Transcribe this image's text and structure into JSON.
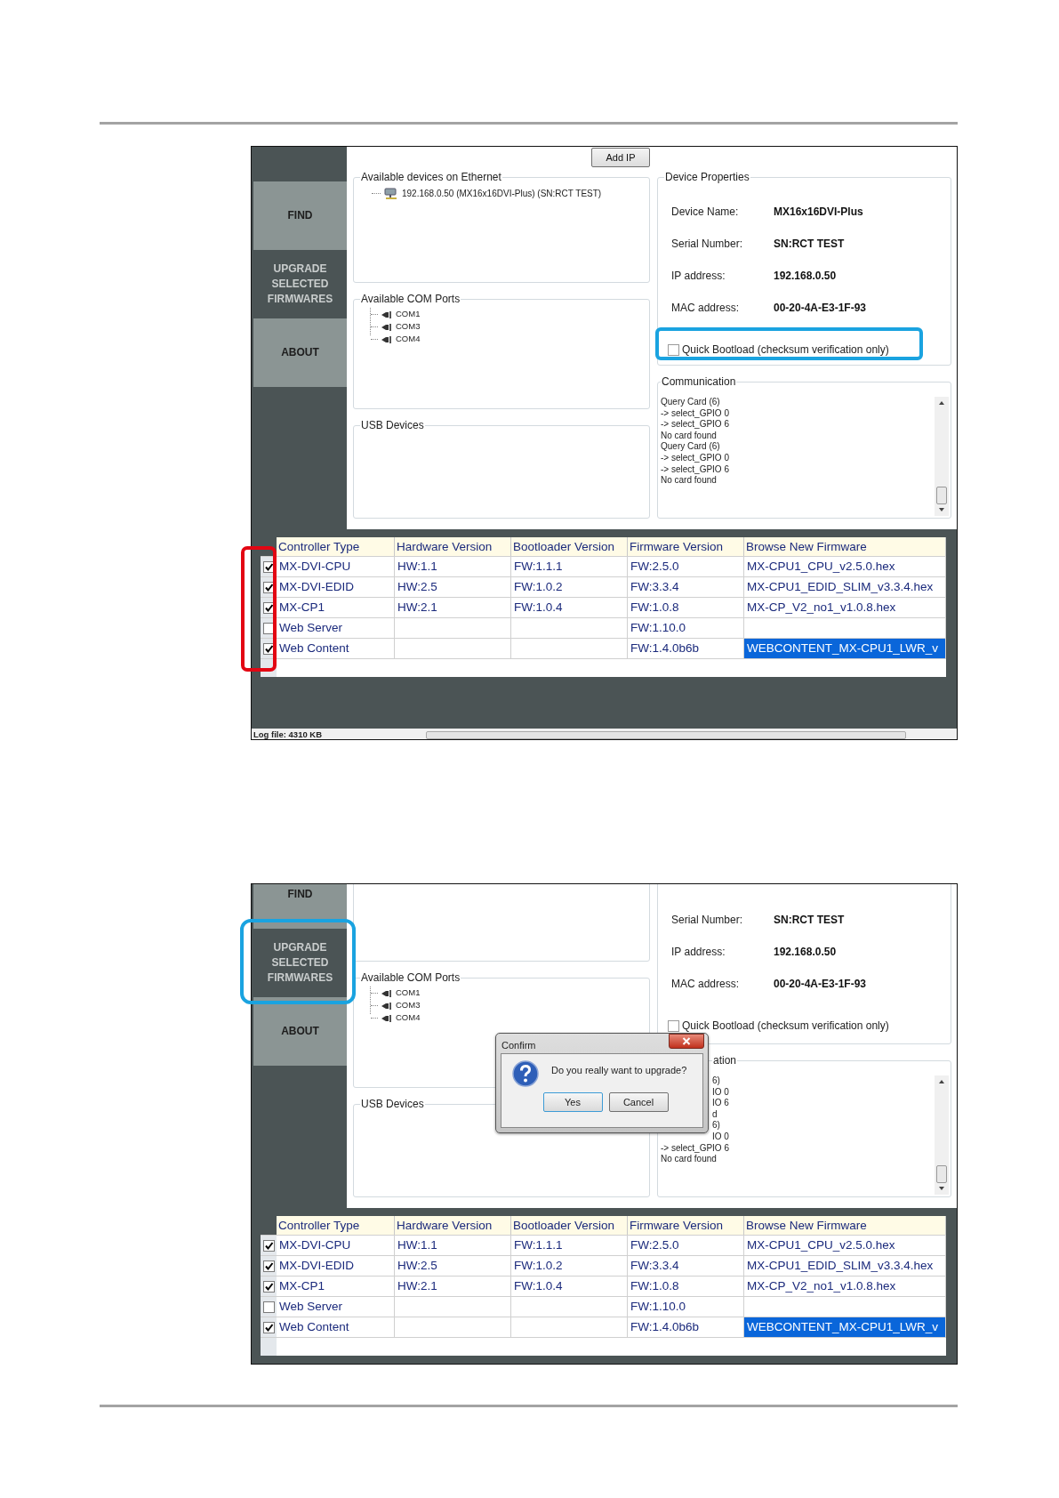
{
  "screenshots": [
    {
      "kind": "full",
      "sidebar": [
        {
          "label": "FIND",
          "selected": false
        },
        {
          "label": "UPGRADE SELECTED FIRMWARES",
          "selected": true
        },
        {
          "label": "ABOUT",
          "selected": false
        }
      ],
      "add_ip_button": "Add IP",
      "ethernet": {
        "title": "Available devices on Ethernet",
        "devices": [
          "192.168.0.50 (MX16x16DVI-Plus) (SN:RCT TEST)"
        ]
      },
      "com_ports": {
        "title": "Available COM Ports",
        "ports": [
          "COM1",
          "COM3",
          "COM4"
        ]
      },
      "usb": {
        "title": "USB Devices"
      },
      "device_properties": {
        "title": "Device Properties",
        "fields": [
          {
            "label": "Device Name:",
            "value": "MX16x16DVI-Plus"
          },
          {
            "label": "Serial Number:",
            "value": "SN:RCT TEST"
          },
          {
            "label": "IP address:",
            "value": "192.168.0.50"
          },
          {
            "label": "MAC address:",
            "value": "00-20-4A-E3-1F-93"
          }
        ],
        "quick_bootload": {
          "label": "Quick Bootload (checksum verification only)",
          "checked": false
        }
      },
      "communication": {
        "title": {
          "text": "Communication",
          "kind": "whole"
        },
        "log": [
          {
            "text": "Query Card (6)",
            "kind": "whole"
          },
          {
            "text": "-> select_GPIO 0",
            "kind": "whole"
          },
          {
            "text": "-> select_GPIO 6",
            "kind": "whole"
          },
          {
            "text": "No card found",
            "kind": "whole"
          },
          {
            "text": "Query Card (6)",
            "kind": "whole"
          },
          {
            "text": "-> select_GPIO 0",
            "kind": "whole"
          },
          {
            "text": "-> select_GPIO 6",
            "kind": "whole"
          },
          {
            "text": "No card found",
            "kind": "whole"
          }
        ]
      },
      "table": {
        "columns": [
          "Controller Type",
          "Hardware Version",
          "Bootloader Version",
          "Firmware Version",
          "Browse New Firmware"
        ],
        "rows": [
          {
            "checked": true,
            "selected": false,
            "cells": [
              "MX-DVI-CPU",
              "HW:1.1",
              "FW:1.1.1",
              "FW:2.5.0",
              "MX-CPU1_CPU_v2.5.0.hex"
            ]
          },
          {
            "checked": true,
            "selected": false,
            "cells": [
              "MX-DVI-EDID",
              "HW:2.5",
              "FW:1.0.2",
              "FW:3.3.4",
              "MX-CPU1_EDID_SLIM_v3.3.4.hex"
            ]
          },
          {
            "checked": true,
            "selected": false,
            "cells": [
              "MX-CP1",
              "HW:2.1",
              "FW:1.0.4",
              "FW:1.0.8",
              "MX-CP_V2_no1_v1.0.8.hex"
            ]
          },
          {
            "checked": false,
            "selected": false,
            "cells": [
              "Web Server",
              "",
              "",
              "FW:1.10.0",
              ""
            ]
          },
          {
            "checked": true,
            "selected": true,
            "cells": [
              "Web Content",
              "",
              "",
              "FW:1.4.0b6b",
              "WEBCONTENT_MX-CPU1_LWR_v"
            ]
          }
        ]
      },
      "status_bar": {
        "log_file": "Log file: 4310 KB"
      },
      "highlights": [
        {
          "color": "#e30613"
        },
        {
          "color": "#1aa3e0"
        }
      ]
    },
    {
      "kind": "cropped",
      "sidebar": [
        {
          "label": "FIND",
          "selected": false
        },
        {
          "label": "UPGRADE SELECTED FIRMWARES",
          "selected": true
        },
        {
          "label": "ABOUT",
          "selected": false
        }
      ],
      "com_ports": {
        "title": "Available COM Ports",
        "ports": [
          "COM1",
          "COM3",
          "COM4"
        ]
      },
      "usb": {
        "title": "USB Devices"
      },
      "device_properties": {
        "fields": [
          {
            "label": "Serial Number:",
            "value": "SN:RCT TEST"
          },
          {
            "label": "IP address:",
            "value": "192.168.0.50"
          },
          {
            "label": "MAC address:",
            "value": "00-20-4A-E3-1F-93"
          }
        ],
        "quick_bootload": {
          "label": "Quick Bootload (checksum verification only)",
          "checked": false
        }
      },
      "communication": {
        "title": {
          "text": "ation",
          "kind": "fragment"
        },
        "log": [
          {
            "text": "6)",
            "kind": "fragment"
          },
          {
            "text": "IO 0",
            "kind": "fragment"
          },
          {
            "text": "IO 6",
            "kind": "fragment"
          },
          {
            "text": "d",
            "kind": "fragment"
          },
          {
            "text": "6)",
            "kind": "fragment"
          },
          {
            "text": "IO 0",
            "kind": "fragment"
          },
          {
            "text": "-> select_GPIO 6",
            "kind": "whole"
          },
          {
            "text": "No card found",
            "kind": "whole"
          }
        ]
      },
      "table": {
        "columns": [
          "Controller Type",
          "Hardware Version",
          "Bootloader Version",
          "Firmware Version",
          "Browse New Firmware"
        ],
        "rows": [
          {
            "checked": true,
            "selected": false,
            "cells": [
              "MX-DVI-CPU",
              "HW:1.1",
              "FW:1.1.1",
              "FW:2.5.0",
              "MX-CPU1_CPU_v2.5.0.hex"
            ]
          },
          {
            "checked": true,
            "selected": false,
            "cells": [
              "MX-DVI-EDID",
              "HW:2.5",
              "FW:1.0.2",
              "FW:3.3.4",
              "MX-CPU1_EDID_SLIM_v3.3.4.hex"
            ]
          },
          {
            "checked": true,
            "selected": false,
            "cells": [
              "MX-CP1",
              "HW:2.1",
              "FW:1.0.4",
              "FW:1.0.8",
              "MX-CP_V2_no1_v1.0.8.hex"
            ]
          },
          {
            "checked": false,
            "selected": false,
            "cells": [
              "Web Server",
              "",
              "",
              "FW:1.10.0",
              ""
            ]
          },
          {
            "checked": true,
            "selected": true,
            "cells": [
              "Web Content",
              "",
              "",
              "FW:1.4.0b6b",
              "WEBCONTENT_MX-CPU1_LWR_v"
            ]
          }
        ]
      },
      "dialog": {
        "title": "Confirm",
        "message": "Do you really want to upgrade?",
        "buttons": [
          {
            "label": "Yes",
            "selected": true
          },
          {
            "label": "Cancel",
            "selected": false
          }
        ]
      },
      "highlights": [
        {
          "color": "#1aa3e0"
        }
      ]
    }
  ]
}
